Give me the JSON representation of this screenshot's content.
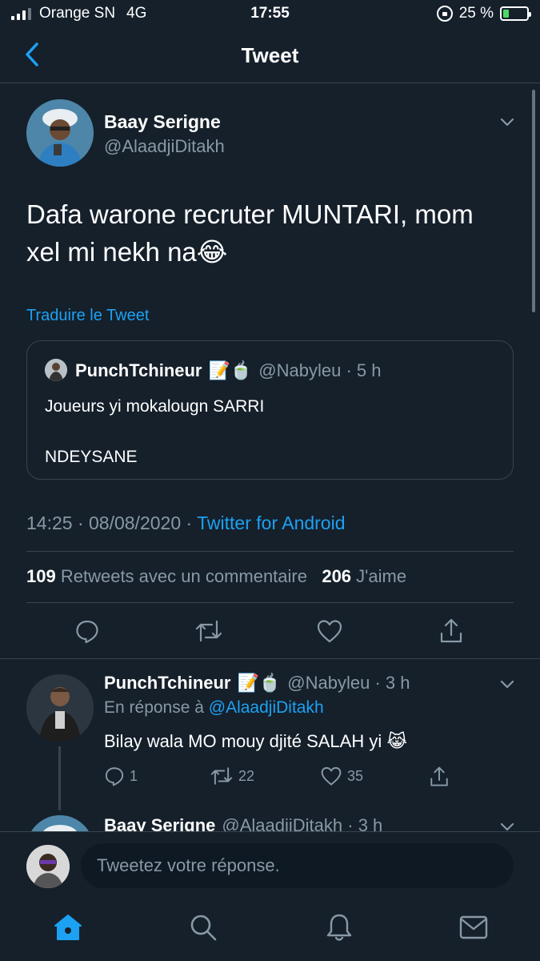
{
  "status_bar": {
    "carrier": "Orange SN",
    "network": "4G",
    "time": "17:55",
    "battery_label": "25 %",
    "battery_level": 0.25
  },
  "nav": {
    "title": "Tweet"
  },
  "main_tweet": {
    "author_name": "Baay Serigne",
    "author_handle": "@AlaadjiDitakh",
    "text_line1": "Dafa warone recruter MUNTARI, mom",
    "text_line2": "xel mi nekh na",
    "text_emoji": "😂",
    "translate_link": "Traduire le Tweet",
    "quote": {
      "author_name": "PunchTchineur",
      "author_emoji": "📝🍵",
      "meta": "@Nabyleu · 5 h",
      "line1": "Joueurs yi mokalougn SARRI",
      "line2": "NDEYSANE"
    },
    "timestamp": "14:25 · 08/08/2020 · ",
    "source": "Twitter for Android",
    "retweets_count": "109",
    "retweets_label": "Retweets avec un commentaire",
    "likes_count": "206",
    "likes_label": "J'aime"
  },
  "reply": {
    "author_name": "PunchTchineur",
    "author_emoji": "📝🍵",
    "meta": "@Nabyleu · 3 h",
    "in_reply_prefix": "En réponse à ",
    "in_reply_handle": "@AlaadjiDitakh",
    "text": "Bilay wala MO mouy djité SALAH yi ",
    "text_emoji": "😹",
    "reply_count": "1",
    "retweet_count": "22",
    "like_count": "35"
  },
  "next_reply_peek": {
    "author_name": "Baay Serigne",
    "meta": "@AlaadjiDitakh · 3 h"
  },
  "compose": {
    "placeholder": "Tweetez votre réponse."
  },
  "colors": {
    "background": "#15202b",
    "border": "#38444d",
    "muted": "#8899a6",
    "accent": "#1da1f2"
  },
  "icons": [
    "back-icon",
    "chevron-down-icon",
    "reply-icon",
    "retweet-icon",
    "like-icon",
    "share-icon",
    "home-icon",
    "search-icon",
    "notifications-icon",
    "messages-icon"
  ]
}
